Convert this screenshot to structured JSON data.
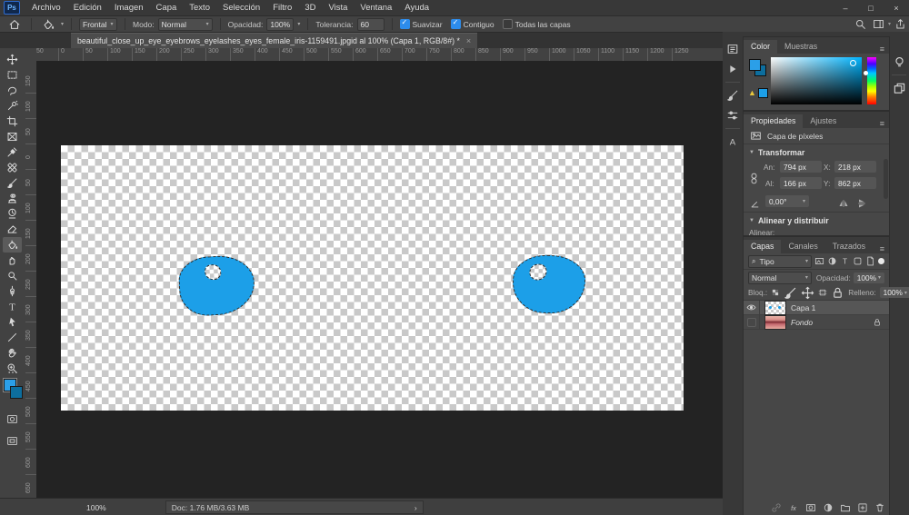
{
  "accent_blue": "#1c9fe8",
  "menubar": {
    "logo": "Ps",
    "items": [
      "Archivo",
      "Edición",
      "Imagen",
      "Capa",
      "Texto",
      "Selección",
      "Filtro",
      "3D",
      "Vista",
      "Ventana",
      "Ayuda"
    ],
    "window_controls": [
      "–",
      "□",
      "×"
    ]
  },
  "options_bar": {
    "sample_mode": "Frontal",
    "modo_label": "Modo:",
    "modo_value": "Normal",
    "opacidad_label": "Opacidad:",
    "opacidad_value": "100%",
    "tolerancia_label": "Tolerancia:",
    "tolerancia_value": "60",
    "checkboxes": [
      {
        "label": "Suavizar",
        "checked": true
      },
      {
        "label": "Contiguo",
        "checked": true
      },
      {
        "label": "Todas las capas",
        "checked": false
      }
    ],
    "right_icons": [
      "search",
      "workspace",
      "share"
    ]
  },
  "document_tab": {
    "title": "beautiful_close_up_eye_eyebrows_eyelashes_eyes_female_iris-1159491.jpgid al 100% (Capa 1, RGB/8#) *",
    "close": "×"
  },
  "toolbar": {
    "selected_tool": "paint-bucket",
    "tools": [
      "move",
      "marquee",
      "lasso",
      "quick-selection",
      "crop",
      "frame",
      "eyedropper",
      "healing-brush",
      "brush",
      "clone-stamp",
      "history-brush",
      "eraser",
      "paint-bucket",
      "smudge",
      "dodge",
      "pen",
      "type",
      "path-selection",
      "shape",
      "hand",
      "zoom"
    ],
    "extras": [
      "ellipsis",
      "quick-mask",
      "screen-mode"
    ],
    "foreground_color": "#2b9fe8",
    "background_color": "#0d6e9e"
  },
  "rulers": {
    "horizontal_labels": [
      "50",
      "0",
      "50",
      "100",
      "150",
      "200",
      "250",
      "300",
      "350",
      "400",
      "450",
      "500",
      "550",
      "600",
      "650",
      "700",
      "750",
      "800",
      "850",
      "900",
      "950",
      "1000",
      "1050",
      "1100",
      "1150",
      "1200",
      "1250"
    ],
    "vertical_labels": [
      "150",
      "100",
      "50",
      "0",
      "50",
      "100",
      "150",
      "200",
      "250",
      "300",
      "350",
      "400",
      "450",
      "500",
      "550",
      "600",
      "650"
    ]
  },
  "canvas": {
    "blob_color": "#1c9fe8",
    "description": "transparent document with two blue filled selections"
  },
  "panel_rail_left": [
    "history",
    "actions",
    "brush-settings",
    "tool-presets",
    "glyphs"
  ],
  "panel_rail_right": [
    "learn",
    "libraries"
  ],
  "color_panel": {
    "tabs": [
      "Color",
      "Muestras"
    ],
    "active_tab": "Color",
    "field_hue": "#00b4ff"
  },
  "properties_panel": {
    "tabs": [
      "Propiedades",
      "Ajustes"
    ],
    "active_tab": "Propiedades",
    "layer_type": "Capa de píxeles",
    "transform_title": "Transformar",
    "an_label": "An:",
    "an_value": "794 px",
    "x_label": "X:",
    "x_value": "218 px",
    "al_label": "Al:",
    "al_value": "166 px",
    "y_label": "Y:",
    "y_value": "862 px",
    "angle_value": "0,00°",
    "align_title": "Alinear y distribuir",
    "align_label": "Alinear:"
  },
  "layers_panel": {
    "tabs": [
      "Capas",
      "Canales",
      "Trazados"
    ],
    "active_tab": "Capas",
    "filter_label": "Tipo",
    "filter_icons": [
      "pixel-filter",
      "adjustment-filter",
      "type-filter",
      "shape-filter",
      "smart-filter"
    ],
    "blend_mode": "Normal",
    "opacidad_label": "Opacidad:",
    "opacidad_value": "100%",
    "bloq_label": "Bloq.:",
    "lock_icons": [
      "lock-transparency",
      "lock-paint",
      "lock-move",
      "lock-artboard",
      "lock-all"
    ],
    "relleno_label": "Relleno:",
    "relleno_value": "100%",
    "layers": [
      {
        "name": "Capa 1",
        "visible": true,
        "selected": true,
        "locked": false,
        "thumb": "checker"
      },
      {
        "name": "Fondo",
        "visible": false,
        "selected": false,
        "locked": true,
        "thumb": "photo"
      }
    ],
    "bottom_icons": [
      "link",
      "fx",
      "mask",
      "adjustment",
      "group",
      "new-layer",
      "delete"
    ]
  },
  "status_bar": {
    "zoom": "100%",
    "doc_info": "Doc: 1.76 MB/3.63 MB",
    "chevron": "›"
  }
}
